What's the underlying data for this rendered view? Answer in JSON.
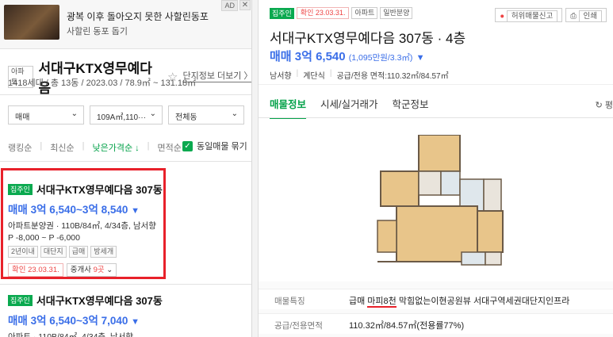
{
  "ad": {
    "thumb_text": "",
    "title": "광복 이후 돌아오지 못한 사할린동포",
    "subtitle": "사할린 동포 돕기",
    "badge": "AD",
    "close": "✕"
  },
  "complex": {
    "type_tag": "아파트",
    "name": "서대구KTX영무예다음",
    "star": "☆",
    "more_link": "단지정보 더보기 〉",
    "summary": "1418세대 / 총 13동 / 2023.03 / 78.9㎡ ~ 131.18㎡"
  },
  "filters": {
    "trade": "매매",
    "area": "109A㎡,110···",
    "dong": "전체동",
    "arrow": "⌄"
  },
  "sort": {
    "items": [
      "랭킹순",
      "최신순",
      "낮은가격순 ↓",
      "면적순"
    ],
    "separator": "|",
    "same_listing_label": "동일매물 묶기",
    "same_listing_checked": true,
    "check_mark": "✓"
  },
  "listings": [
    {
      "badge": "집주인",
      "name": "서대구KTX영무예다음 307동",
      "price": "매매 3억 6,540~3억 8,540",
      "arrow": "▼",
      "info": "아파트분양권 · 110B/84㎡, 4/34층, 남서향",
      "info2": "P -8,000 ~ P -6,000",
      "tags": [
        "2년이내",
        "대단지",
        "급매",
        "방세개"
      ],
      "confirm": "확인 23.03.31.",
      "broker_text": "중개사 ",
      "broker_count": "9곳",
      "broker_arrow": " ⌄"
    },
    {
      "badge": "집주인",
      "name": "서대구KTX영무예다음 307동",
      "price": "매매 3억 6,540~3억 7,040",
      "arrow": "▼",
      "info": "아파트 · 110B/84㎡, 4/34층, 남서향"
    }
  ],
  "detail": {
    "badges": [
      "집주인",
      "확인 23.03.31.",
      "아파트",
      "일반분양"
    ],
    "actions": {
      "report": "허위매물신고",
      "print": "인쇄"
    },
    "title": "서대구KTX영무예다음 307동 · 4층",
    "price": "매매 3억 6,540",
    "unit_price": "(1,095만원/3.3㎡)",
    "arrow": "▼",
    "info": [
      "남서향",
      "계단식",
      "공급/전용 면적:110.32㎡/84.57㎡"
    ],
    "info_sep": "|",
    "tabs": [
      "매물정보",
      "시세/실거래가",
      "학군정보"
    ],
    "refresh_label": "↻ 평",
    "rows": [
      {
        "key": "매물특징",
        "value_pre": "급매 ",
        "value_ul": "마피8천",
        "value_post": " 막힘없는이현공원뷰 서대구역세권대단지인프라"
      },
      {
        "key": "공급/전용면적",
        "value": "110.32㎡/84.57㎡(전용률77%)"
      }
    ]
  },
  "colors": {
    "accent_green": "#05a24a",
    "price_blue": "#3a6ee8",
    "highlight_red": "#e8212a"
  }
}
